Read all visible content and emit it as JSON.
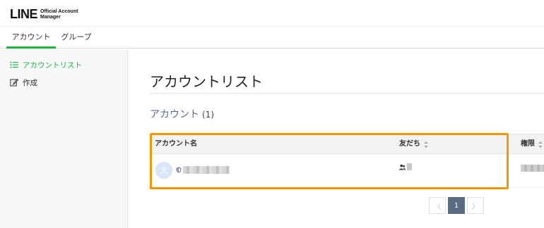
{
  "header": {
    "logo_main": "LINE",
    "logo_sub_line1": "Official Account",
    "logo_sub_line2": "Manager"
  },
  "tabs": [
    {
      "label": "アカウント",
      "active": true
    },
    {
      "label": "グループ",
      "active": false
    }
  ],
  "sidebar": {
    "items": [
      {
        "label": "アカウントリスト",
        "icon": "list-icon",
        "active": true
      },
      {
        "label": "作成",
        "icon": "edit-icon",
        "active": false
      }
    ]
  },
  "main": {
    "page_title": "アカウントリスト",
    "section_title": "アカウント",
    "section_count": "(1)",
    "table": {
      "columns": [
        {
          "label": "アカウント名",
          "sortable": false
        },
        {
          "label": "友だち",
          "sortable": true
        },
        {
          "label": "権限",
          "sortable": true
        }
      ]
    },
    "pagination": {
      "prev_glyph": "〈",
      "current": "1",
      "next_glyph": "〉"
    }
  },
  "colors": {
    "accent_green": "#1eb53a",
    "highlight_orange": "#f39800",
    "pager_current": "#5b6b82"
  }
}
